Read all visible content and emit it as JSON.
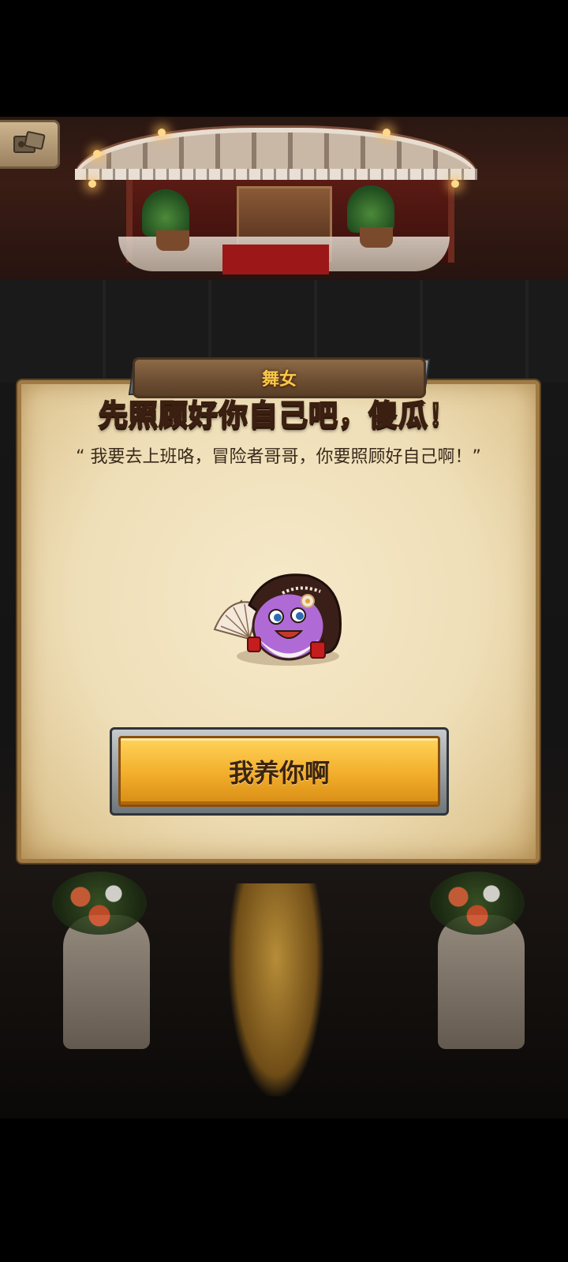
{
  "dialog": {
    "character_name": "舞女",
    "title": "先照顾好你自己吧，傻瓜！",
    "quote": "“ 我要去上班咯，冒险者哥哥，你要照顾好自己啊！”",
    "button_label": "我养你啊"
  },
  "icons": {
    "corner": "movie-ticket-icon",
    "character": "dancer-egg-avatar"
  },
  "colors": {
    "title_gold": "#f2c23d",
    "button_orange": "#f2ad2a",
    "parchment": "#f6e9c9"
  }
}
